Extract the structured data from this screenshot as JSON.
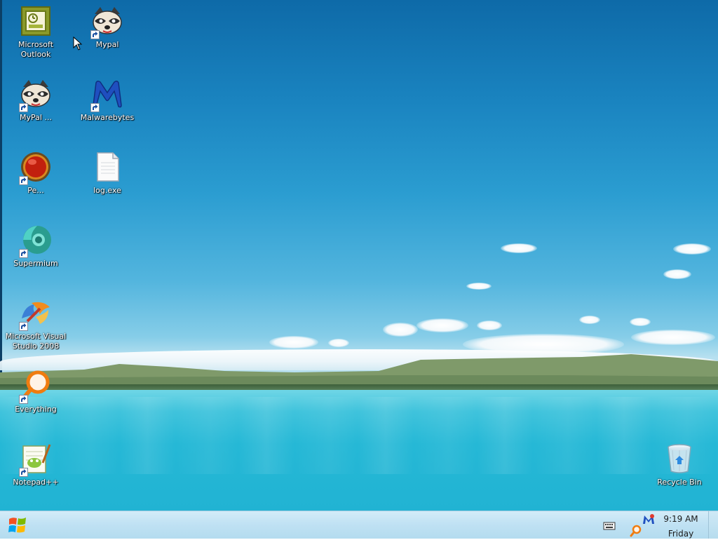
{
  "desktop": {
    "icons": [
      {
        "label": "Microsoft Outlook",
        "icon": "outlook-icon",
        "shortcut": false
      },
      {
        "label": "Mypal",
        "icon": "raccoon-icon",
        "shortcut": true
      },
      {
        "label": "MyPal ...",
        "icon": "raccoon-icon",
        "shortcut": true
      },
      {
        "label": "Malwarebytes",
        "icon": "malwarebytes-icon",
        "shortcut": true
      },
      {
        "label": "Pe...",
        "icon": "red-orb-icon",
        "shortcut": true
      },
      {
        "label": "log.exe",
        "icon": "document-icon",
        "shortcut": false
      },
      {
        "label": "Supermium",
        "icon": "supermium-icon",
        "shortcut": true
      },
      {
        "label": "Microsoft Visual Studio 2008",
        "icon": "visual-studio-icon",
        "shortcut": true
      },
      {
        "label": "Everything",
        "icon": "magnifier-icon",
        "shortcut": true
      },
      {
        "label": "Notepad++",
        "icon": "notepadpp-icon",
        "shortcut": true
      },
      {
        "label": "Recycle Bin",
        "icon": "recycle-bin-icon",
        "shortcut": false
      }
    ]
  },
  "taskbar": {
    "start_icon": "windows-logo-icon",
    "tray_icons": [
      "keyboard-icon",
      "malwarebytes-tray-icon",
      "search-tray-icon"
    ],
    "clock": {
      "time": "9:19 AM",
      "day": "Friday"
    }
  },
  "colors": {
    "taskbar": "#bfe1f3",
    "sky_top": "#0e6aa8",
    "lake": "#25b8d6"
  }
}
